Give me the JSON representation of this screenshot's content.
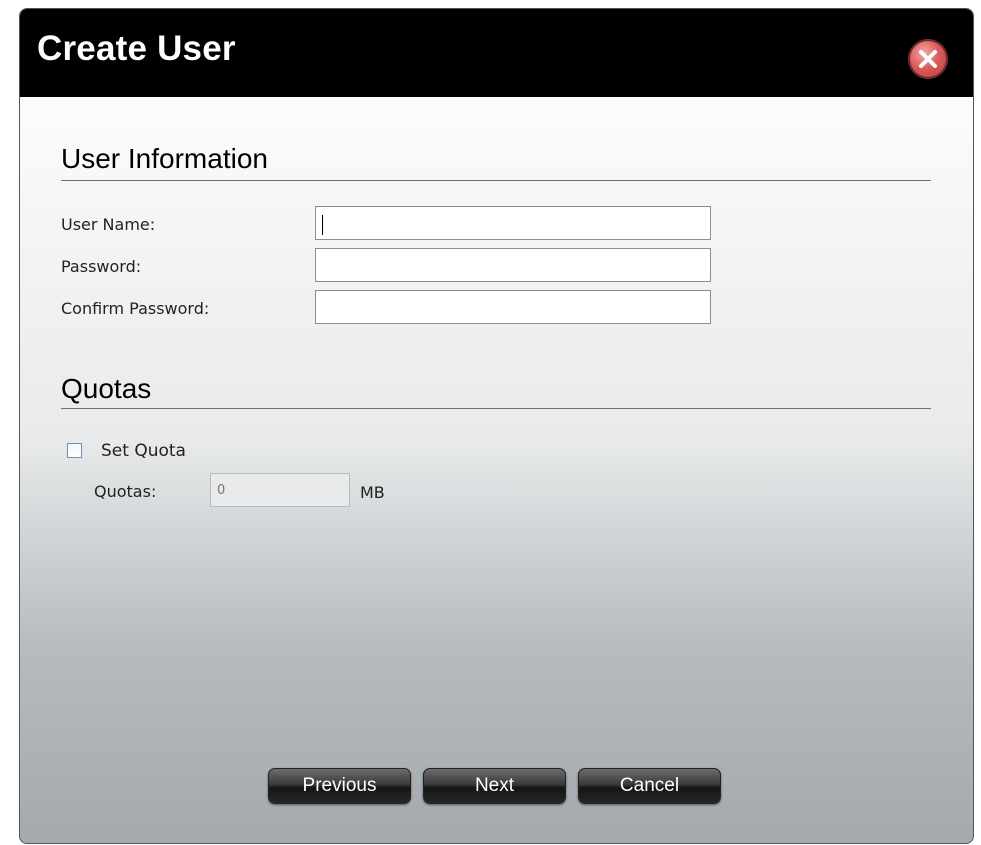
{
  "dialog": {
    "title": "Create User",
    "close_icon": "close-x-icon"
  },
  "user_info": {
    "heading": "User Information",
    "username_label": "User Name:",
    "username_value": "",
    "password_label": "Password:",
    "password_value": "",
    "confirm_label": "Confirm Password:",
    "confirm_value": ""
  },
  "quotas": {
    "heading": "Quotas",
    "set_quota_label": "Set Quota",
    "set_quota_checked": false,
    "quotas_label": "Quotas:",
    "quotas_placeholder": "0",
    "unit": "MB"
  },
  "buttons": {
    "previous": "Previous",
    "next": "Next",
    "cancel": "Cancel"
  },
  "colors": {
    "titlebar": "#000000",
    "close_button": "#d85a5a"
  }
}
